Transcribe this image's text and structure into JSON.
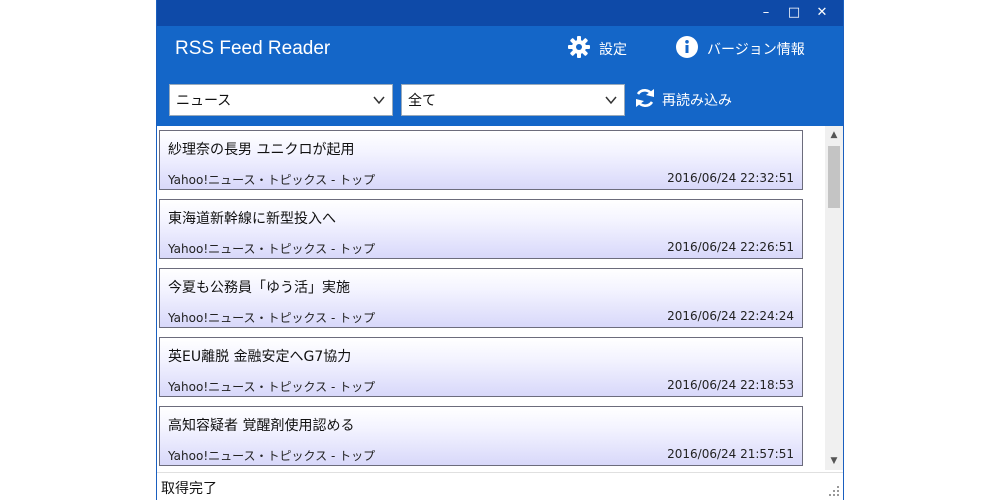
{
  "window": {
    "minimize_glyph": "–",
    "maximize_glyph": "□",
    "close_glyph": "✕"
  },
  "header": {
    "title": "RSS Feed Reader",
    "settings_label": "設定",
    "version_label": "バージョン情報",
    "settings_icon": "gear-icon",
    "version_icon": "info-icon"
  },
  "filters": {
    "category_selected": "ニュース",
    "range_selected": "全て",
    "reload_label": "再読み込み",
    "reload_icon": "refresh-icon"
  },
  "feed": {
    "items": [
      {
        "title": "紗理奈の長男 ユニクロが起用",
        "source": "Yahoo!ニュース・トピックス - トップ",
        "date": "2016/06/24 22:32:51"
      },
      {
        "title": "東海道新幹線に新型投入へ",
        "source": "Yahoo!ニュース・トピックス - トップ",
        "date": "2016/06/24 22:26:51"
      },
      {
        "title": "今夏も公務員「ゆう活」実施",
        "source": "Yahoo!ニュース・トピックス - トップ",
        "date": "2016/06/24 22:24:24"
      },
      {
        "title": "英EU離脱 金融安定へG7協力",
        "source": "Yahoo!ニュース・トピックス - トップ",
        "date": "2016/06/24 22:18:53"
      },
      {
        "title": "高知容疑者 覚醒剤使用認める",
        "source": "Yahoo!ニュース・トピックス - トップ",
        "date": "2016/06/24 21:57:51"
      }
    ]
  },
  "status": {
    "text": "取得完了"
  },
  "colors": {
    "titlebar": "#0e4aa8",
    "header": "#1466c8",
    "item_border": "#6c6c7c",
    "item_gradient_end": "#d8d8fa"
  }
}
